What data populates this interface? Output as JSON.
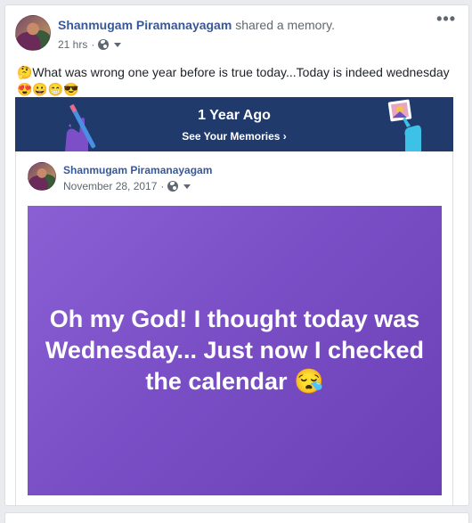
{
  "post": {
    "author": "Shanmugam Piramanayagam",
    "action": "shared a memory.",
    "time": "21 hrs",
    "separator": "·",
    "more": "•••",
    "text": "🤔What was wrong one year before is true today...Today is indeed wednesday",
    "emojis": "😍😀😁😎"
  },
  "memory_banner": {
    "title": "1 Year Ago",
    "link": "See Your Memories ›"
  },
  "shared_post": {
    "author": "Shanmugam Piramanayagam",
    "date": "November 28, 2017",
    "separator": "·",
    "text": "Oh my God! I thought today was Wednesday... Just now I checked the calendar 😪"
  },
  "colors": {
    "banner_bg": "#203b6b",
    "link_blue": "#385898",
    "post_purple": "#7a4fc6"
  }
}
